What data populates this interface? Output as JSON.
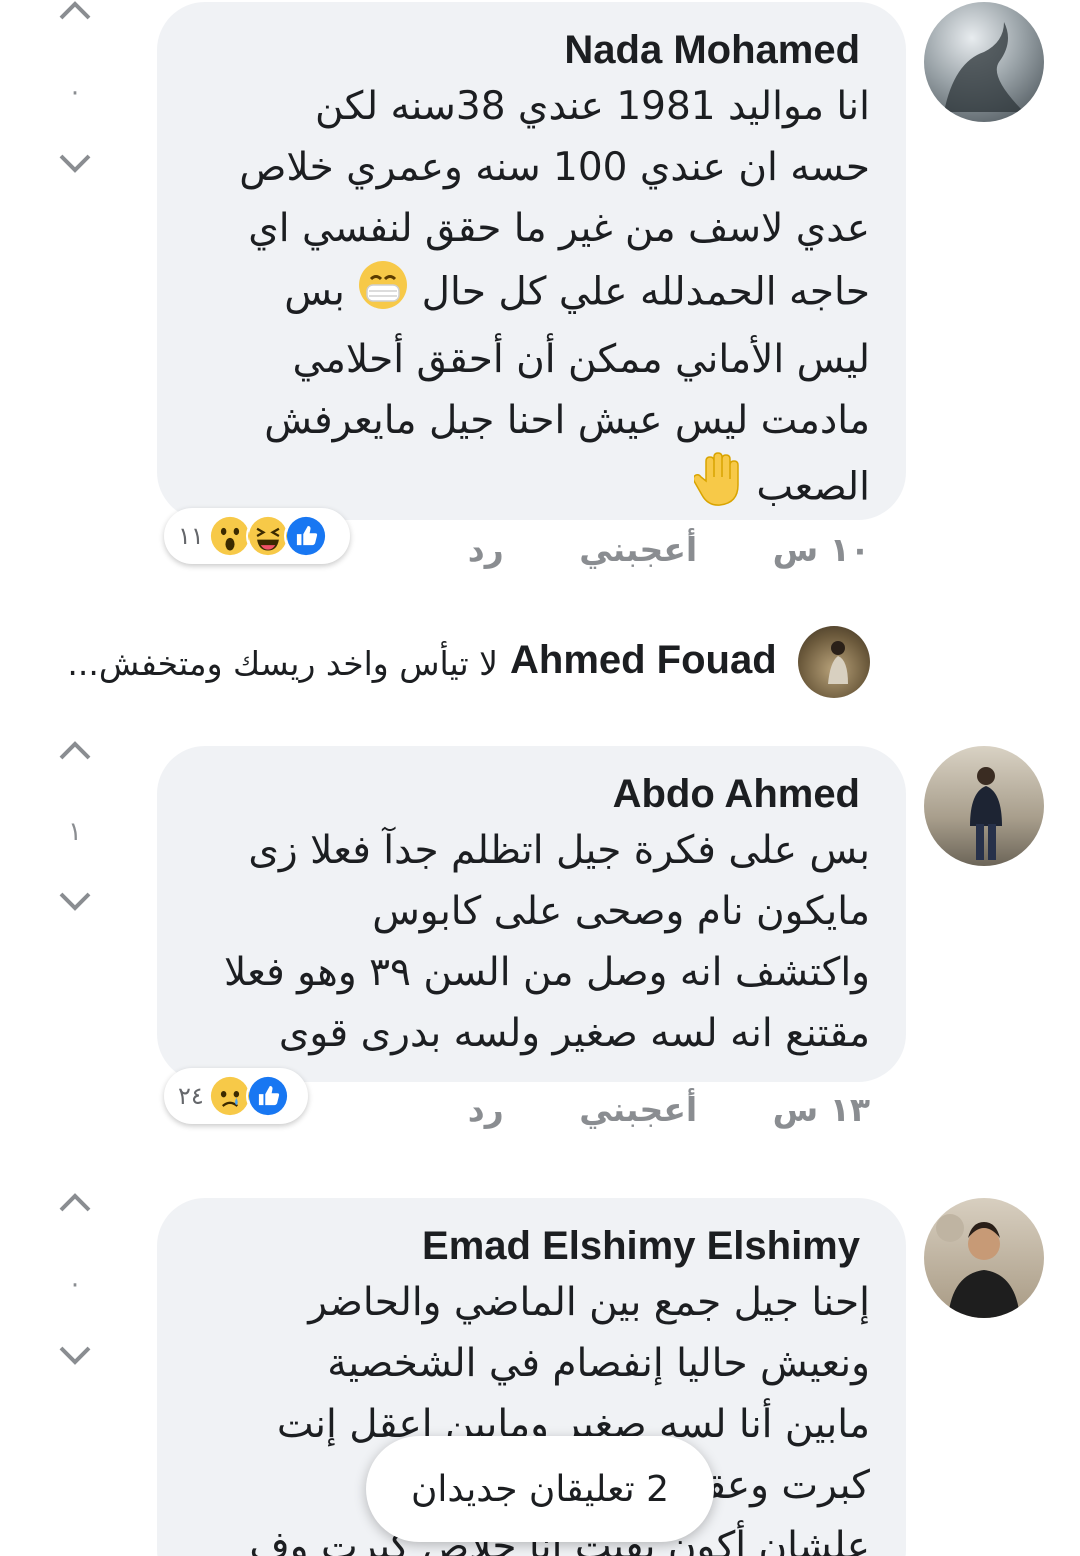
{
  "comments": [
    {
      "author": "Nada Mohamed",
      "lines": [
        "انا مواليد 1981 عندي 38سنه لكن",
        "حسه ان عندي 100 سنه وعمري خلاص",
        "عدي لاسف من غير ما حقق لنفسي اي",
        "حاجه الحمدلله علي كل حال",
        "ليس الأماني ممكن أن أحقق أحلامي",
        "مادمت ليس عيش احنا جيل مايعرفش",
        "الصعب"
      ],
      "line4_tail": "بس",
      "time": "١٠ س",
      "like_label": "أعجبني",
      "reply_label": "رد",
      "vote_count": "·",
      "reaction_count": "١١"
    },
    {
      "author": "Abdo Ahmed",
      "lines": [
        "بس على فكرة جيل اتظلم جدآ فعلا زى",
        "مايكون نام وصحى على كابوس",
        "واكتشف انه وصل من السن ٣٩ وهو فعلا",
        "مقتنع انه لسه صغير ولسه بدرى قوى"
      ],
      "time": "١٣ س",
      "like_label": "أعجبني",
      "reply_label": "رد",
      "vote_count": "١",
      "reaction_count": "٢٤"
    },
    {
      "author": "Emad Elshimy Elshimy",
      "lines": [
        "إحنا جيل جمع بين الماضي والحاضر",
        "ونعيش حاليا إنفصام في الشخصية",
        "مابين أنا لسه صغير ومابين اعقل إنت",
        "كبرت وعقلت والبس إيه",
        "علشان أكون بقيت أنا خلاص كبرت وف"
      ],
      "vote_count": "·"
    }
  ],
  "reply": {
    "author": "Ahmed Fouad",
    "text": "لا تيأس واخد ريسك ومتخفش..."
  },
  "toast": {
    "label": "2 تعليقان جديدان"
  },
  "colors": {
    "bubble": "#f0f2f5",
    "meta": "#8a8d91",
    "like_blue": "#1877f2",
    "emoji_yellow": "#f7c948"
  }
}
